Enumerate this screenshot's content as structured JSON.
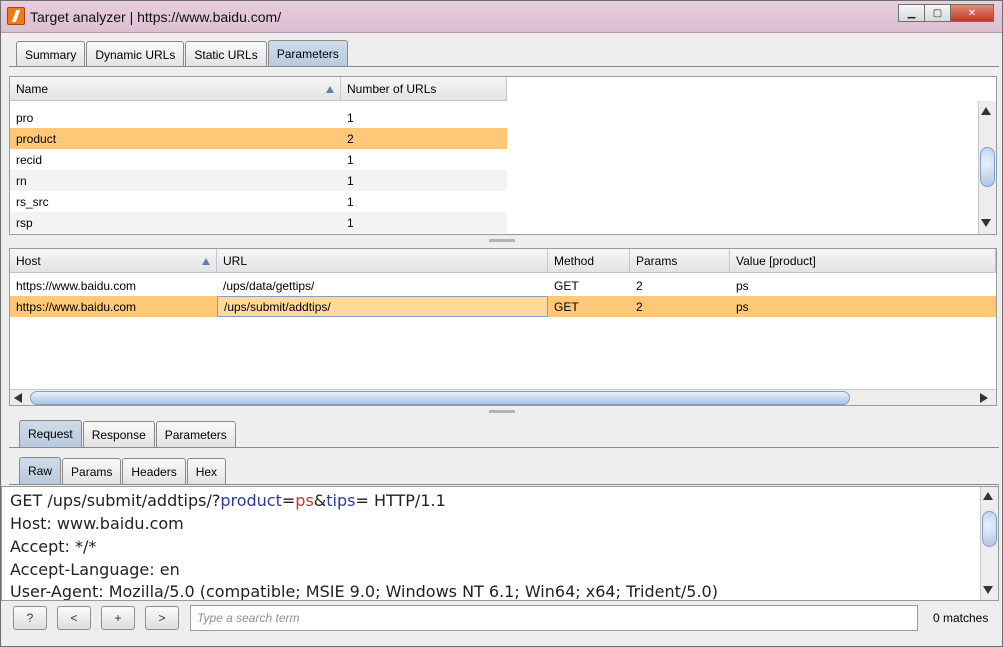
{
  "window": {
    "title": "Target analyzer | https://www.baidu.com/",
    "btn_minimize": "▁",
    "btn_restore": "▢",
    "btn_close": "✕"
  },
  "top_tabs": [
    {
      "label": "Summary"
    },
    {
      "label": "Dynamic URLs"
    },
    {
      "label": "Static URLs"
    },
    {
      "label": "Parameters"
    }
  ],
  "param_table": {
    "headers": [
      "Name",
      "Number of URLs"
    ],
    "rows": [
      {
        "name": "pro",
        "count": "1"
      },
      {
        "name": "product",
        "count": "2"
      },
      {
        "name": "recid",
        "count": "1"
      },
      {
        "name": "rn",
        "count": "1"
      },
      {
        "name": "rs_src",
        "count": "1"
      },
      {
        "name": "rsp",
        "count": "1"
      }
    ]
  },
  "url_table": {
    "headers": [
      "Host",
      "URL",
      "Method",
      "Params",
      "Value [product]"
    ],
    "rows": [
      {
        "host": "https://www.baidu.com",
        "url": "/ups/data/gettips/",
        "method": "GET",
        "params": "2",
        "value": "ps"
      },
      {
        "host": "https://www.baidu.com",
        "url": "/ups/submit/addtips/",
        "method": "GET",
        "params": "2",
        "value": "ps"
      }
    ]
  },
  "message_tabs": [
    {
      "label": "Request"
    },
    {
      "label": "Response"
    },
    {
      "label": "Parameters"
    }
  ],
  "view_tabs": [
    {
      "label": "Raw"
    },
    {
      "label": "Params"
    },
    {
      "label": "Headers"
    },
    {
      "label": "Hex"
    }
  ],
  "request": {
    "line1_prefix": "GET /ups/submit/addtips/?",
    "p1_name": "product",
    "eq1": "=",
    "p1_value": "ps",
    "amp": "&",
    "p2_name": "tips",
    "line1_suffix": "= HTTP/1.1",
    "lines": [
      "Host: www.baidu.com",
      "Accept: */*",
      "Accept-Language: en",
      "User-Agent: Mozilla/5.0 (compatible; MSIE 9.0; Windows NT 6.1; Win64; x64; Trident/5.0)"
    ]
  },
  "search": {
    "help_label": "?",
    "prev_label": "<",
    "add_label": "+",
    "next_label": ">",
    "placeholder": "Type a search term",
    "matches": "0 matches"
  },
  "colors": {
    "selection": "#ffc878",
    "param_name": "#2c3a9e",
    "param_value": "#c0392b"
  }
}
